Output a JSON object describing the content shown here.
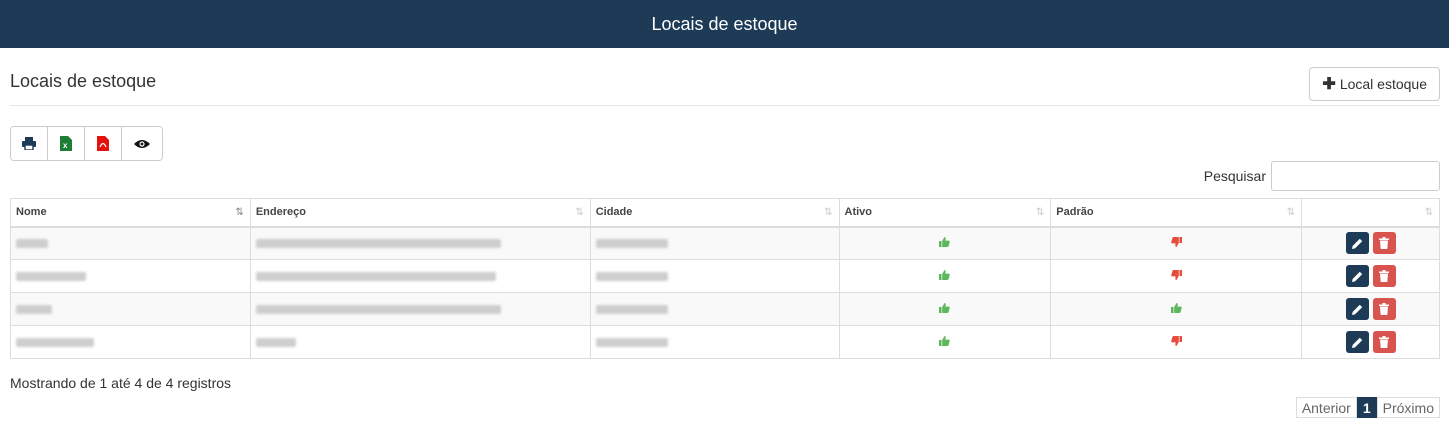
{
  "header": {
    "title": "Locais de estoque"
  },
  "page": {
    "title": "Locais de estoque",
    "add_button_label": "Local estoque"
  },
  "export_buttons": [
    {
      "icon": "print-icon"
    },
    {
      "icon": "excel-icon"
    },
    {
      "icon": "pdf-icon"
    },
    {
      "icon": "eye-icon"
    }
  ],
  "search": {
    "label": "Pesquisar",
    "value": ""
  },
  "table": {
    "columns": [
      "Nome",
      "Endereço",
      "Cidade",
      "Ativo",
      "Padrão",
      ""
    ],
    "rows": [
      {
        "ativo": "thumbs-up",
        "padrao": "thumbs-down"
      },
      {
        "ativo": "thumbs-up",
        "padrao": "thumbs-down"
      },
      {
        "ativo": "thumbs-up",
        "padrao": "thumbs-up"
      },
      {
        "ativo": "thumbs-up",
        "padrao": "thumbs-down"
      }
    ]
  },
  "footer": {
    "info": "Mostrando de 1 até 4 de 4 registros"
  },
  "pagination": {
    "prev": "Anterior",
    "current": "1",
    "next": "Próximo"
  },
  "colors": {
    "primary": "#1d3a56",
    "danger": "#d9534f",
    "success": "#5cb85c",
    "down": "#e74c3c"
  }
}
